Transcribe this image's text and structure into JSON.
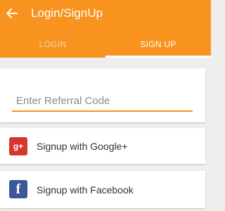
{
  "header": {
    "title": "Login/SignUp",
    "back_icon": "arrow-left-icon",
    "color": "#f7931e"
  },
  "tabs": [
    {
      "label": "LOGIN",
      "active": false
    },
    {
      "label": "SIGN UP",
      "active": true
    }
  ],
  "referral": {
    "placeholder": "Enter Referral Code",
    "value": ""
  },
  "social": {
    "google": {
      "label": "Signup with Google+",
      "icon": "google-plus-icon",
      "glyph": "g+",
      "color": "#d9362b"
    },
    "facebook": {
      "label": "Signup with Facebook",
      "icon": "facebook-icon",
      "glyph": "f",
      "color": "#3b5998"
    }
  }
}
